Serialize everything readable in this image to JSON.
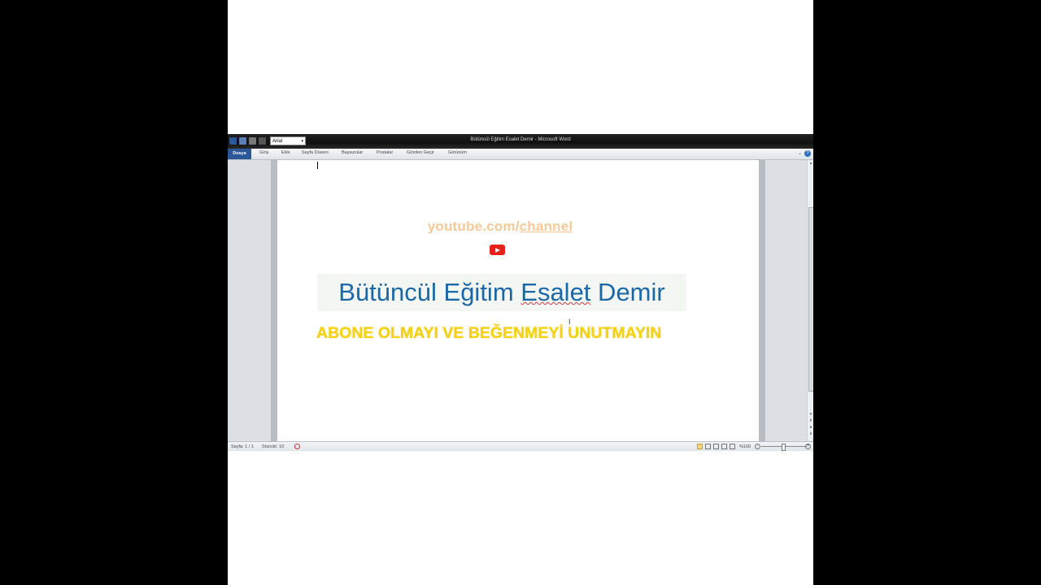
{
  "window": {
    "title": "Bütüncül Eğitim Esalet Demir - Microsoft Word"
  },
  "quick_access": {
    "font_name": "Arial"
  },
  "ribbon": {
    "tabs": [
      {
        "label": "Dosya"
      },
      {
        "label": "Giriş"
      },
      {
        "label": "Ekle"
      },
      {
        "label": "Sayfa Düzeni"
      },
      {
        "label": "Başvurular"
      },
      {
        "label": "Postalar"
      },
      {
        "label": "Gözden Geçir"
      },
      {
        "label": "Görünüm"
      }
    ]
  },
  "document": {
    "link_prefix": "youtube.com/",
    "link_underlined": "channel",
    "heading": {
      "part1": "Bütüncül Eğitim ",
      "part2": "Esalet",
      "part3": " Demir"
    },
    "subscribe_text": "ABONE OLMAYI VE BEĞENMEYİ UNUTMAYIN"
  },
  "status": {
    "page": "Sayfa: 1 / 1",
    "words": "Sözcük: 10",
    "zoom": "%100"
  },
  "colors": {
    "heading": "#1a68a8",
    "subscribe": "#f5d313",
    "link": "#f6c998",
    "youtube_red": "#e62117",
    "file_tab": "#2b5797"
  }
}
